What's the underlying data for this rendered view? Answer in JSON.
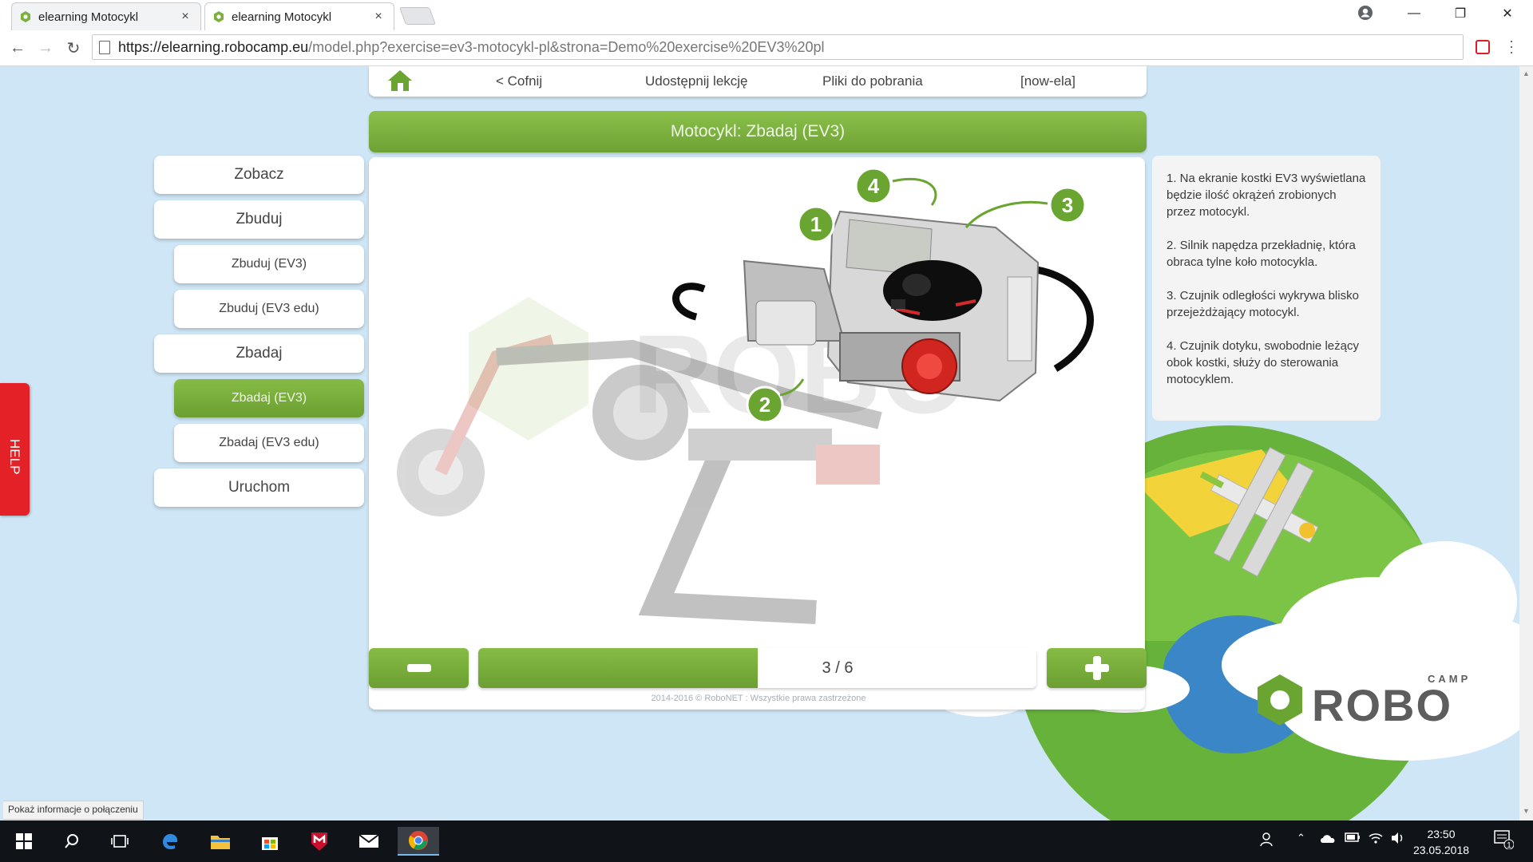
{
  "browser": {
    "tabs": [
      {
        "title": "elearning Motocykl",
        "close": "×"
      },
      {
        "title": "elearning Motocykl",
        "close": "×"
      }
    ],
    "window_controls": {
      "minimize": "—",
      "restore": "❐",
      "close": "✕"
    },
    "url_host": "https://elearning.robocamp.eu",
    "url_rest": "/model.php?exercise=ev3-motocykl-pl&strona=Demo%20exercise%20EV3%20pl",
    "status_text": "Pokaż informacje o połączeniu"
  },
  "topnav": {
    "back": "< Cofnij",
    "share": "Udostępnij lekcję",
    "downloads": "Pliki do pobrania",
    "user": "[now-ela]"
  },
  "header": {
    "title": "Motocykl: Zbadaj (EV3)"
  },
  "sidebar": {
    "items": [
      {
        "label": "Zobacz",
        "level": 1,
        "selected": false
      },
      {
        "label": "Zbuduj",
        "level": 1,
        "selected": false
      },
      {
        "label": "Zbuduj (EV3)",
        "level": 2,
        "selected": false
      },
      {
        "label": "Zbuduj (EV3 edu)",
        "level": 2,
        "selected": false
      },
      {
        "label": "Zbadaj",
        "level": 1,
        "selected": false
      },
      {
        "label": "Zbadaj (EV3)",
        "level": 2,
        "selected": true
      },
      {
        "label": "Zbadaj (EV3 edu)",
        "level": 2,
        "selected": false
      },
      {
        "label": "Uruchom",
        "level": 1,
        "selected": false
      }
    ]
  },
  "viewer": {
    "callouts": [
      "1",
      "2",
      "3",
      "4"
    ],
    "watermark": "ROBO"
  },
  "info": {
    "paragraphs": [
      "1. Na ekranie kostki EV3 wyświetlana będzie ilość okrążeń zrobionych przez motocykl.",
      "2. Silnik napędza przekładnię, która obraca tylne koło motocykla.",
      "3. Czujnik odległości wykrywa blisko przejeżdżający motocykl.",
      "4. Czujnik dotyku, swobodnie leżący obok kostki, służy do sterowania motocyklem."
    ]
  },
  "pager": {
    "current": 3,
    "total": 6,
    "label": "3 / 6",
    "progress_fraction": 0.5
  },
  "footer": {
    "copyright": "2014-2016 © RoboNET : Wszystkie prawa zastrzeżone"
  },
  "help": {
    "label": "HELP"
  },
  "logo": {
    "robo": "ROBO",
    "camp": "CAMP"
  },
  "taskbar": {
    "time": "23:50",
    "date": "23.05.2018",
    "notifications": "1"
  },
  "colors": {
    "accent_green": "#7bb03c",
    "help_red": "#e32126",
    "page_bg": "#cfe6f6"
  }
}
